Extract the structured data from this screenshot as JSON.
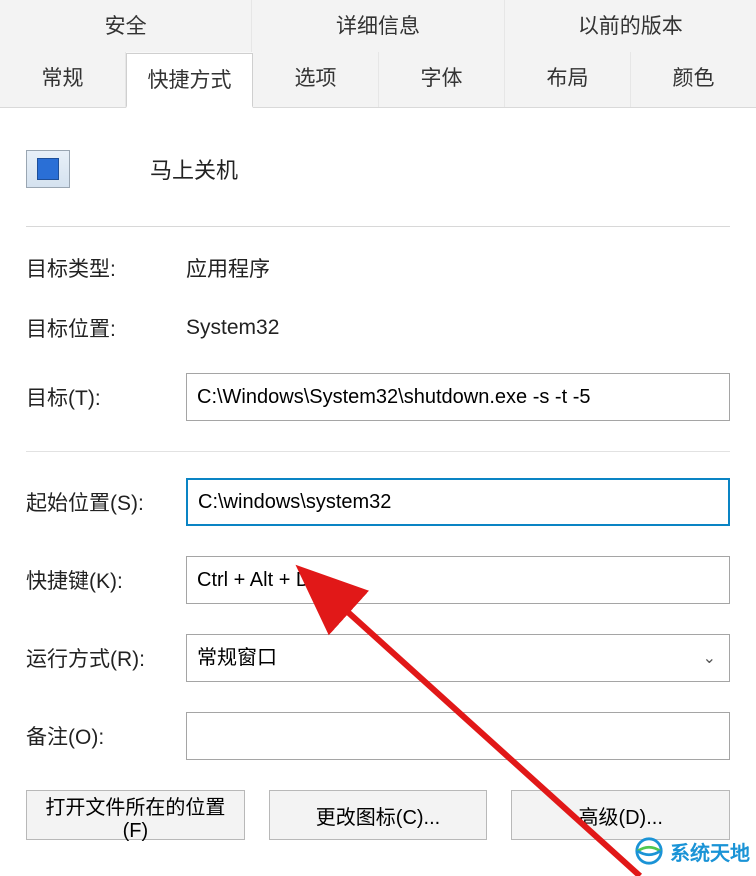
{
  "tabs": {
    "row1": [
      "安全",
      "详细信息",
      "以前的版本"
    ],
    "row2": [
      "常规",
      "快捷方式",
      "选项",
      "字体",
      "布局",
      "颜色"
    ],
    "active": "快捷方式"
  },
  "shortcut_name": "马上关机",
  "fields": {
    "target_type": {
      "label": "目标类型:",
      "value": "应用程序"
    },
    "target_location": {
      "label": "目标位置:",
      "value": "System32"
    },
    "target": {
      "label": "目标(T):",
      "value": "C:\\Windows\\System32\\shutdown.exe -s -t -5"
    },
    "start_in": {
      "label": "起始位置(S):",
      "value": "C:\\windows\\system32"
    },
    "shortcut_key": {
      "label": "快捷键(K):",
      "value": "Ctrl + Alt + D"
    },
    "run": {
      "label": "运行方式(R):",
      "value": "常规窗口"
    },
    "comment": {
      "label": "备注(O):",
      "value": ""
    }
  },
  "buttons": {
    "open_location": "打开文件所在的位置(F)",
    "change_icon": "更改图标(C)...",
    "advanced": "高级(D)..."
  },
  "watermark": "系统天地"
}
